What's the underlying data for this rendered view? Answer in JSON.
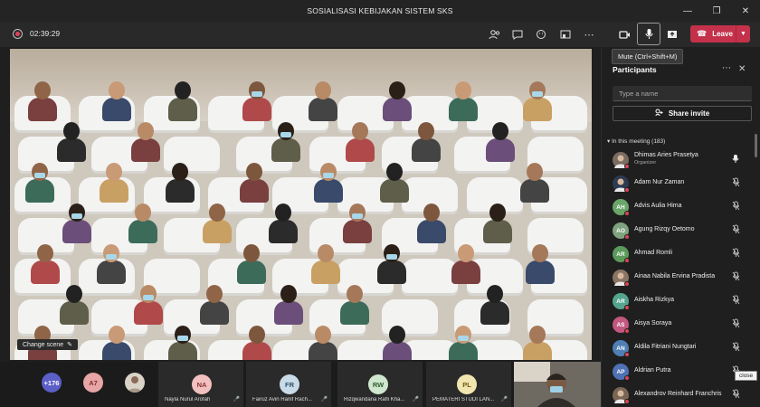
{
  "window": {
    "title": "SOSIALISASI KEBIJAKAN SISTEM SKS"
  },
  "callbar": {
    "timer": "02:39:29",
    "leave_label": "Leave",
    "mute_tooltip": "Mute (Ctrl+Shift+M)"
  },
  "stage": {
    "change_scene_label": "Change scene"
  },
  "strip": {
    "overflow_count": "+176",
    "avatars": [
      {
        "initials": "A7",
        "color": "#e8a5a5"
      }
    ],
    "tiles": [
      {
        "initials": "NA",
        "name": "Nayla Nurul Arofah",
        "color": "#f2c0c0"
      },
      {
        "initials": "FR",
        "name": "Fairuz Avin Hanif Rach...",
        "color": "#c9dbe8"
      },
      {
        "initials": "RW",
        "name": "Rizqwandana Rafli Kha...",
        "color": "#cfe6cf"
      },
      {
        "initials": "PL",
        "name": "PEMATERI STUDI LAN...",
        "color": "#f1e6b0"
      }
    ]
  },
  "participants": {
    "title": "Participants",
    "search_placeholder": "Type a name",
    "share_invite_label": "Share invite",
    "section_label": "In this meeting (183)",
    "list": [
      {
        "initials": "",
        "name": "Dhimas Aries Prasetya",
        "sub": "Organizer",
        "color": "#7a6c60",
        "mic": "on"
      },
      {
        "initials": "",
        "name": "Adam Nur Zaman",
        "sub": "",
        "color": "#2c3a52",
        "mic": "off"
      },
      {
        "initials": "AH",
        "name": "Advis Aulia Hima",
        "sub": "",
        "color": "#6aa56a",
        "mic": "off"
      },
      {
        "initials": "AO",
        "name": "Agung Rizqy Oetomo",
        "sub": "",
        "color": "#7fa37f",
        "mic": "off"
      },
      {
        "initials": "AR",
        "name": "Ahmad Romli",
        "sub": "",
        "color": "#5b9a5b",
        "mic": "off"
      },
      {
        "initials": "",
        "name": "Ainaa Nabila Ervina Pradista",
        "sub": "",
        "color": "#8a7565",
        "mic": "off"
      },
      {
        "initials": "AR",
        "name": "Aiskha Rizkya",
        "sub": "",
        "color": "#55a58e",
        "mic": "off"
      },
      {
        "initials": "AS",
        "name": "Aisya Soraya",
        "sub": "",
        "color": "#c2577f",
        "mic": "off"
      },
      {
        "initials": "AN",
        "name": "Aldila Fitriani Nungtari",
        "sub": "",
        "color": "#4f7fb4",
        "mic": "off"
      },
      {
        "initials": "AP",
        "name": "Aldrian Putra",
        "sub": "",
        "color": "#4f72b4",
        "mic": "off"
      },
      {
        "initials": "",
        "name": "Alexandrov Reinhard Franchris",
        "sub": "",
        "color": "#7b6655",
        "mic": "off"
      }
    ],
    "close_tooltip": "close"
  }
}
